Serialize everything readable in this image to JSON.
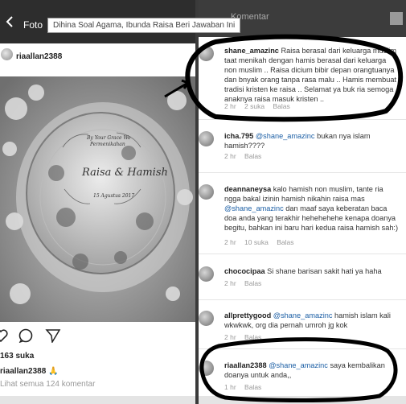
{
  "left": {
    "title": "Foto",
    "headline": "Dihina Soal Agama, Ibunda Raisa Beri Jawaban Ini",
    "username": "riaallan2388",
    "likes": "163 suka",
    "caption_user": "riaallan2388",
    "caption_emoji": "🙏",
    "view_all": "Lihat semua 124 komentar"
  },
  "right": {
    "title": "Komentar",
    "comments": [
      {
        "user": "shane_amazinc",
        "text": "Raisa berasal dari keluarga muslim taat menikah dengan hamis berasal dari keluarga non muslim .. Raisa dicium bibir depan orangtuanya dan bnyak orang tanpa rasa malu .. Hamis membuat tradisi kristen ke raisa .. Selamat ya buk ria semoga anaknya raisa masuk kristen ..",
        "time": "2 hr",
        "likes": "2 suka",
        "reply": "Balas"
      },
      {
        "user": "icha.795",
        "mention": "@shane_amazinc",
        "text": "bukan nya islam hamish????",
        "time": "2 hr",
        "reply": "Balas"
      },
      {
        "user": "deannaneysa",
        "text": "kalo hamish non muslim, tante ria ngga bakal izinin hamish nikahin raisa mas",
        "mention": "@shane_amazinc",
        "text2": "dan maaf saya keberatan baca doa anda yang terakhir hehehehehe kenapa doanya begitu, bahkan ini baru hari kedua raisa hamish sah:)",
        "time": "2 hr",
        "likes": "10 suka",
        "reply": "Balas"
      },
      {
        "user": "chococipaa",
        "text": "Si shane barisan sakit hati ya haha",
        "time": "2 hr",
        "reply": "Balas"
      },
      {
        "user": "allprettygood",
        "mention": "@shane_amazinc",
        "text": "hamish islam kali wkwkwk, org dia pernah umroh jg kok",
        "time": "2 hr",
        "reply": "Balas"
      },
      {
        "user": "riaallan2388",
        "mention": "@shane_amazinc",
        "text": "saya kembalikan doanya untuk anda,,",
        "time": "1 hr",
        "reply": "Balas"
      }
    ]
  },
  "colors": {
    "topbar": "#2d2d2d",
    "mention": "#1c5fa5",
    "marker": "#000000"
  },
  "icons": [
    "back-arrow-icon",
    "heart-icon",
    "comment-icon",
    "send-icon",
    "camera-icon"
  ]
}
